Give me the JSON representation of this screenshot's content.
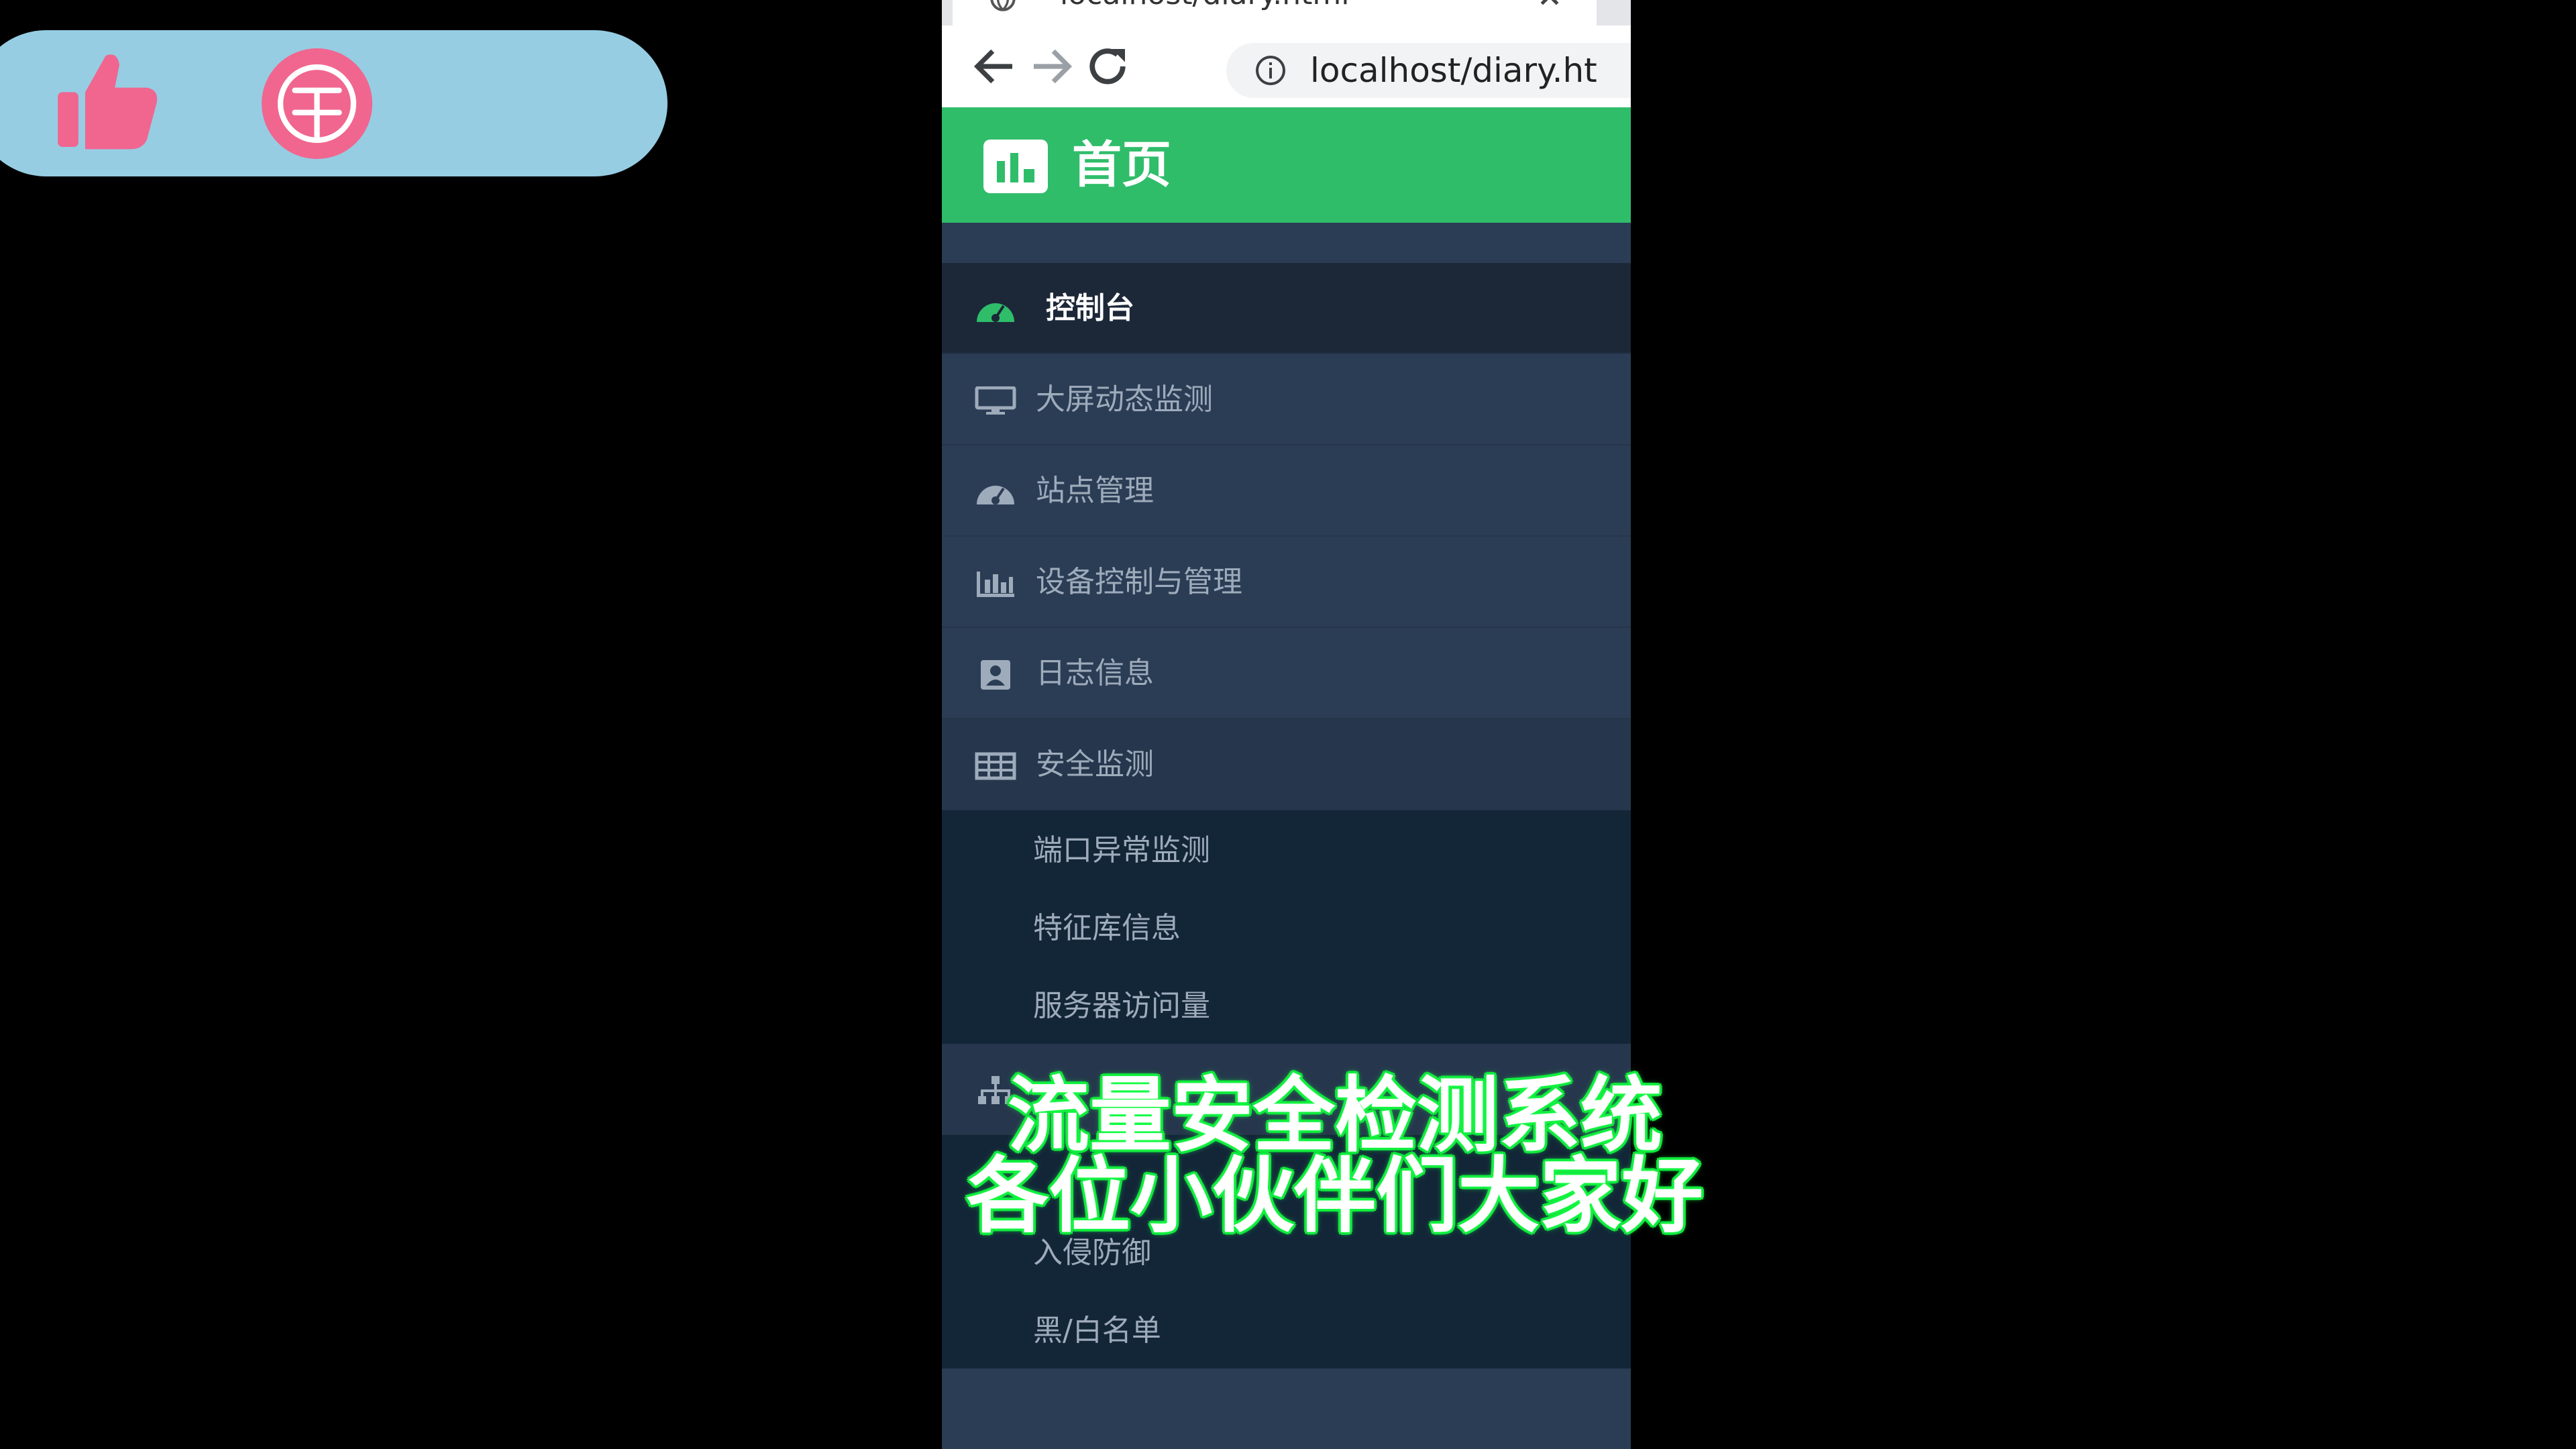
{
  "overlay": {
    "like_icon": "thumbs-up-icon",
    "coin_icon": "coin-icon",
    "coin_glyph": "币",
    "pill_color": "#96cde3",
    "accent_color": "#f0668f"
  },
  "browser": {
    "tab_title": "localhost/diary.html",
    "url": "localhost/diary.ht",
    "icons": [
      "back-arrow-icon",
      "forward-arrow-icon",
      "reload-icon",
      "info-icon",
      "close-icon"
    ]
  },
  "app": {
    "header_title": "首页",
    "header_icon": "bar-chart-icon",
    "header_color": "#2fbd6a",
    "sidebar_color": "#2b3d55"
  },
  "sidebar": {
    "items": [
      {
        "label": "控制台",
        "icon": "dashboard-icon",
        "active": true
      },
      {
        "label": "大屏动态监测",
        "icon": "monitor-icon"
      },
      {
        "label": "站点管理",
        "icon": "dashboard-icon"
      },
      {
        "label": "设备控制与管理",
        "icon": "bar-chart-icon"
      },
      {
        "label": "日志信息",
        "icon": "contact-card-icon"
      },
      {
        "label": "安全监测",
        "icon": "table-icon",
        "expanded": true,
        "children": [
          "端口异常监测",
          "特征库信息",
          "服务器访问量"
        ]
      },
      {
        "label": "",
        "icon": "sitemap-icon",
        "expanded": true,
        "children": [
          "",
          "入侵防御",
          "黑/白名单"
        ]
      }
    ]
  },
  "subtitle": {
    "line1": "流量安全检测系统",
    "line2": "各位小伙伴们大家好",
    "glow_color": "#18ff47"
  }
}
